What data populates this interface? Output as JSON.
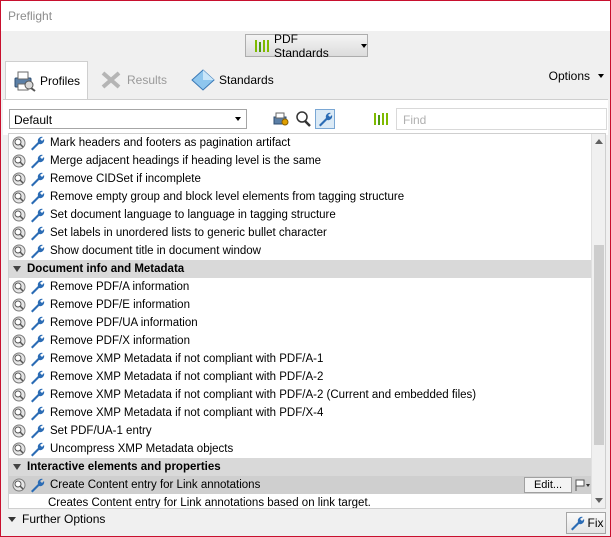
{
  "window": {
    "title": "Preflight"
  },
  "header": {
    "pdf_standards_label": "PDF Standards"
  },
  "tabs": [
    {
      "label": "Profiles"
    },
    {
      "label": "Results"
    },
    {
      "label": "Standards"
    }
  ],
  "options_label": "Options",
  "toolbar": {
    "profile_select_value": "Default",
    "find_placeholder": "Find"
  },
  "list": {
    "rows_top": [
      "Mark headers and footers as pagination artifact",
      "Merge adjacent headings if heading level is the same",
      "Remove CIDSet if incomplete",
      "Remove empty group and block level elements from tagging structure",
      "Set document language to language in tagging structure",
      "Set labels in unordered lists to generic bullet character",
      "Show document title in document window"
    ],
    "group1": "Document info and Metadata",
    "rows_group1": [
      "Remove PDF/A information",
      "Remove PDF/E information",
      "Remove PDF/UA information",
      "Remove PDF/X information",
      "Remove XMP Metadata if not compliant with PDF/A-1",
      "Remove XMP Metadata if not compliant with PDF/A-2",
      "Remove XMP Metadata if not compliant with PDF/A-2 (Current and embedded files)",
      "Remove XMP Metadata if not compliant with PDF/X-4",
      "Set PDF/UA-1 entry",
      "Uncompress XMP Metadata objects"
    ],
    "group2": "Interactive elements and properties",
    "selected_row": "Create Content entry for Link annotations",
    "selected_description": "Creates Content entry for Link annotations based on link target.",
    "edit_label": "Edit..."
  },
  "bottom": {
    "further_options": "Further Options",
    "fix_label": "Fix"
  },
  "colors": {
    "accent_green": "#7fba00",
    "wrench_blue": "#2b6cb5",
    "window_border": "#c8102e"
  }
}
